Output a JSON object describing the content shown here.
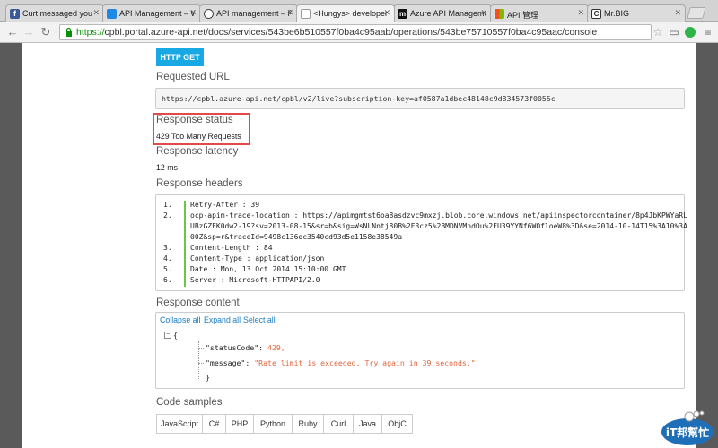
{
  "browser": {
    "tabs": [
      {
        "title": "Curt messaged you",
        "favicon": "facebook-icon",
        "color": "#3b5998"
      },
      {
        "title": "API Management – Wi",
        "favicon": "windows-icon",
        "color": "#1e88e5"
      },
      {
        "title": "API management – Poli",
        "favicon": "cloud-icon",
        "color": "#444444"
      },
      {
        "title": "<Hungys> developer",
        "favicon": "page-icon",
        "color": "#dddddd"
      },
      {
        "title": "Azure API Management",
        "favicon": "m-icon",
        "color": "#111111"
      },
      {
        "title": "API 管理",
        "favicon": "windows-color-icon",
        "color": "#f25022"
      },
      {
        "title": "Mr.BIG",
        "favicon": "c-icon",
        "color": "#333333"
      }
    ],
    "url_scheme": "https://",
    "url_rest": "cpbl.portal.azure-api.net/docs/services/543be6b510557f0ba4c95aab/operations/543be75710557f0ba4c95aac/console"
  },
  "console": {
    "method_button": "HTTP GET",
    "requested_url_label": "Requested URL",
    "requested_url": "https://cpbl.azure-api.net/cpbl/v2/live?subscription-key=af0587a1dbec48148c9d834573f0055c",
    "response_status_label": "Response status",
    "response_status": "429 Too Many Requests",
    "response_latency_label": "Response latency",
    "response_latency": "12 ms",
    "response_headers_label": "Response headers",
    "headers": [
      {
        "num": "1.",
        "text": "Retry-After : 39"
      },
      {
        "num": "2.",
        "text": "ocp-apim-trace-location : https://apimgmtst6oa8asdzvc9mxzj.blob.core.windows.net/apiinspectorcontainer/8p4JbKPWYaRL"
      },
      {
        "num": "",
        "text": "UBzGZEK0dw2-19?sv=2013-08-15&sr=b&sig=WsNLNntj80B%2F3cz5%2BMDNVMndOu%2FU39YYNf6WOfloeW8%3D&se=2014-10-14T15%3A10%3A"
      },
      {
        "num": "",
        "text": "00Z&sp=r&traceId=9498c136ec3540cd93d5e1158e38549a"
      },
      {
        "num": "3.",
        "text": "Content-Length : 84"
      },
      {
        "num": "4.",
        "text": "Content-Type : application/json"
      },
      {
        "num": "5.",
        "text": "Date : Mon, 13 Oct 2014 15:10:00 GMT"
      },
      {
        "num": "6.",
        "text": "Server : Microsoft-HTTPAPI/2.0"
      }
    ],
    "response_content_label": "Response content",
    "collapse_all": "Collapse all",
    "expand_all": "Expand all",
    "select_all": "Select all",
    "json_open": "{",
    "json_close": "}",
    "status_code_key": "\"statusCode\"",
    "status_code_value": "429,",
    "message_key": "\"message\"",
    "message_value": "\"Rate limit is exceeded. Try again in 39 seconds.\"",
    "code_samples_label": "Code samples",
    "code_tabs": [
      "JavaScript",
      "C#",
      "PHP",
      "Python",
      "Ruby",
      "Curl",
      "Java",
      "ObjC"
    ]
  },
  "watermark": {
    "text": "iT邦幫忙"
  }
}
